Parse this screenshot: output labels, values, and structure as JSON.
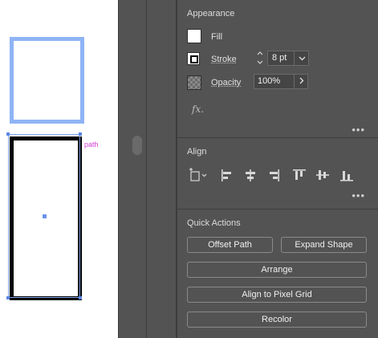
{
  "canvas": {
    "path_label": "path"
  },
  "appearance": {
    "title": "Appearance",
    "fill_label": "Fill",
    "stroke_label": "Stroke",
    "stroke_weight": "8 pt",
    "opacity_label": "Opacity",
    "opacity_value": "100%",
    "fx_label": "fx."
  },
  "align": {
    "title": "Align"
  },
  "quick_actions": {
    "title": "Quick Actions",
    "offset_path": "Offset Path",
    "expand_shape": "Expand Shape",
    "arrange": "Arrange",
    "align_pixel_grid": "Align to Pixel Grid",
    "recolor": "Recolor"
  },
  "more_glyph": "•••",
  "colors": {
    "panel_bg": "#535353",
    "selection": "#5a86e6",
    "path_label": "#d33bd3"
  }
}
